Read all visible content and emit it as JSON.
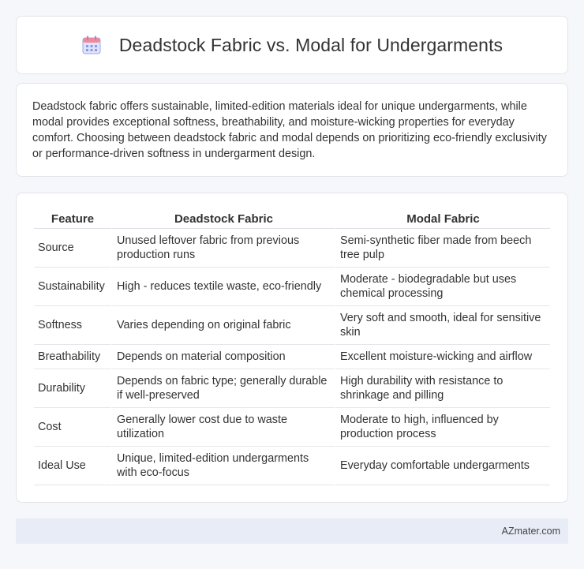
{
  "header": {
    "title": "Deadstock Fabric vs. Modal for Undergarments",
    "icon": "calendar-icon"
  },
  "intro": {
    "text": "Deadstock fabric offers sustainable, limited-edition materials ideal for unique undergarments, while modal provides exceptional softness, breathability, and moisture-wicking properties for everyday comfort. Choosing between deadstock fabric and modal depends on prioritizing eco-friendly exclusivity or performance-driven softness in undergarment design."
  },
  "table": {
    "headers": [
      "Feature",
      "Deadstock Fabric",
      "Modal Fabric"
    ],
    "rows": [
      [
        "Source",
        "Unused leftover fabric from previous production runs",
        "Semi-synthetic fiber made from beech tree pulp"
      ],
      [
        "Sustainability",
        "High - reduces textile waste, eco-friendly",
        "Moderate - biodegradable but uses chemical processing"
      ],
      [
        "Softness",
        "Varies depending on original fabric",
        "Very soft and smooth, ideal for sensitive skin"
      ],
      [
        "Breathability",
        "Depends on material composition",
        "Excellent moisture-wicking and airflow"
      ],
      [
        "Durability",
        "Depends on fabric type; generally durable if well-preserved",
        "High durability with resistance to shrinkage and pilling"
      ],
      [
        "Cost",
        "Generally lower cost due to waste utilization",
        "Moderate to high, influenced by production process"
      ],
      [
        "Ideal Use",
        "Unique, limited-edition undergarments with eco-focus",
        "Everyday comfortable undergarments"
      ]
    ]
  },
  "footer": {
    "brand": "AZmater.com"
  },
  "colors": {
    "background": "#f6f7fb",
    "card": "#ffffff",
    "footer_bg": "#e8ecf6",
    "icon_accent": "#7d8fe6"
  }
}
